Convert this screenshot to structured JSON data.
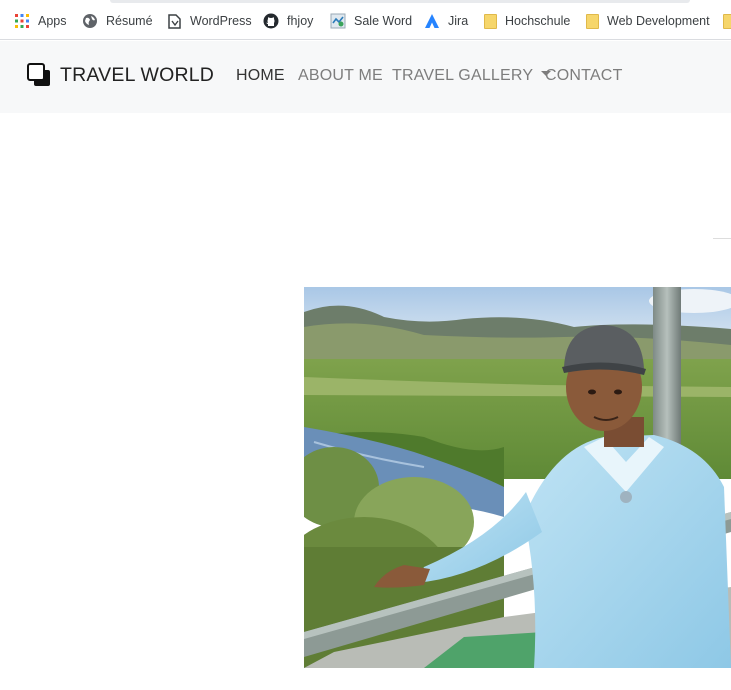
{
  "bookmarks_bar": {
    "items": [
      {
        "label": "Apps",
        "icon": "apps-grid-icon"
      },
      {
        "label": "Résumé",
        "icon": "globe-icon"
      },
      {
        "label": "WordPress",
        "icon": "page-icon"
      },
      {
        "label": "fhjoy",
        "icon": "github-icon"
      },
      {
        "label": "Sale Word",
        "icon": "sale-word-icon"
      },
      {
        "label": "Jira",
        "icon": "jira-icon"
      },
      {
        "label": "Hochschule",
        "icon": "folder-icon"
      },
      {
        "label": "Web Development",
        "icon": "folder-icon"
      }
    ]
  },
  "navbar": {
    "brand": "TRAVEL WORLD",
    "links": [
      {
        "label": "HOME",
        "active": true
      },
      {
        "label": "ABOUT ME",
        "active": false
      },
      {
        "label": "TRAVEL GALLERY",
        "active": false,
        "dropdown": true
      },
      {
        "label": "CONTACT",
        "active": false
      }
    ]
  },
  "hero": {
    "image": "photo of a man in a grey cap and light-blue sweater leaning on a bridge railing over a river, green fields and hills behind"
  },
  "colors": {
    "navbar_bg": "#f7f8f9",
    "nav_active": "#333333",
    "nav_inactive": "#7d7d7d",
    "folder": "#f6d66b"
  }
}
